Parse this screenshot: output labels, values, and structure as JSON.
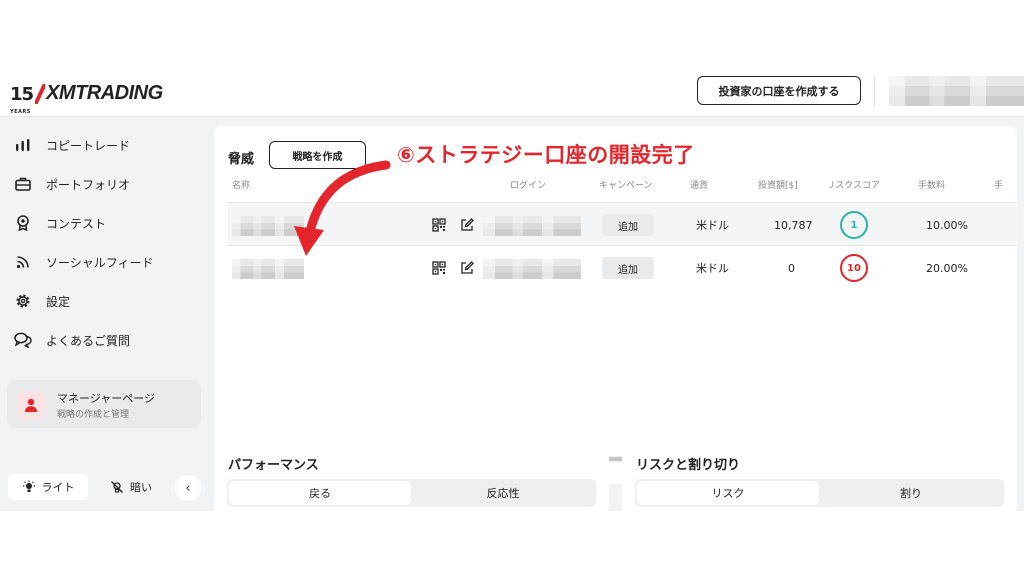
{
  "header": {
    "logo_years_num": "15",
    "logo_years_word": "YEARS",
    "logo_brand": "XMTRADING",
    "create_investor_account": "投資家の口座を作成する"
  },
  "sidebar": {
    "items": [
      {
        "label": "コピートレード",
        "icon": "chart-bars-icon"
      },
      {
        "label": "ポートフォリオ",
        "icon": "briefcase-icon"
      },
      {
        "label": "コンテスト",
        "icon": "medal-icon"
      },
      {
        "label": "ソーシャルフィード",
        "icon": "rss-icon"
      },
      {
        "label": "設定",
        "icon": "gear-icon"
      },
      {
        "label": "よくあるご質問",
        "icon": "chat-bubbles-icon"
      }
    ],
    "manager": {
      "title": "マネージャーページ",
      "subtitle": "戦略の作成と管理"
    },
    "theme_light": "ライト",
    "theme_dark": "暗い"
  },
  "strategies": {
    "title": "脅威",
    "create_button": "戦略を作成",
    "annotation": "⑥ストラテジー口座の開設完了",
    "columns": [
      "名称",
      "ログイン",
      "キャンペーン",
      "通貨",
      "投資額[$]",
      "リスクスコア",
      "手数料",
      "手"
    ],
    "rows": [
      {
        "campaign": "追加",
        "currency": "米ドル",
        "invested": "10,787",
        "risk": "1",
        "fee": "10.00%"
      },
      {
        "campaign": "追加",
        "currency": "米ドル",
        "invested": "0",
        "risk": "10",
        "fee": "20.00%"
      }
    ]
  },
  "performance": {
    "title": "パフォーマンス",
    "tabs": [
      "戻る",
      "反応性"
    ]
  },
  "risk_panel": {
    "title": "リスクと割り切り",
    "tabs": [
      "リスク",
      "割り"
    ]
  },
  "colors": {
    "accent_red": "#e4252b",
    "risk_low": "#2ab5a5",
    "risk_high": "#e4252b"
  }
}
